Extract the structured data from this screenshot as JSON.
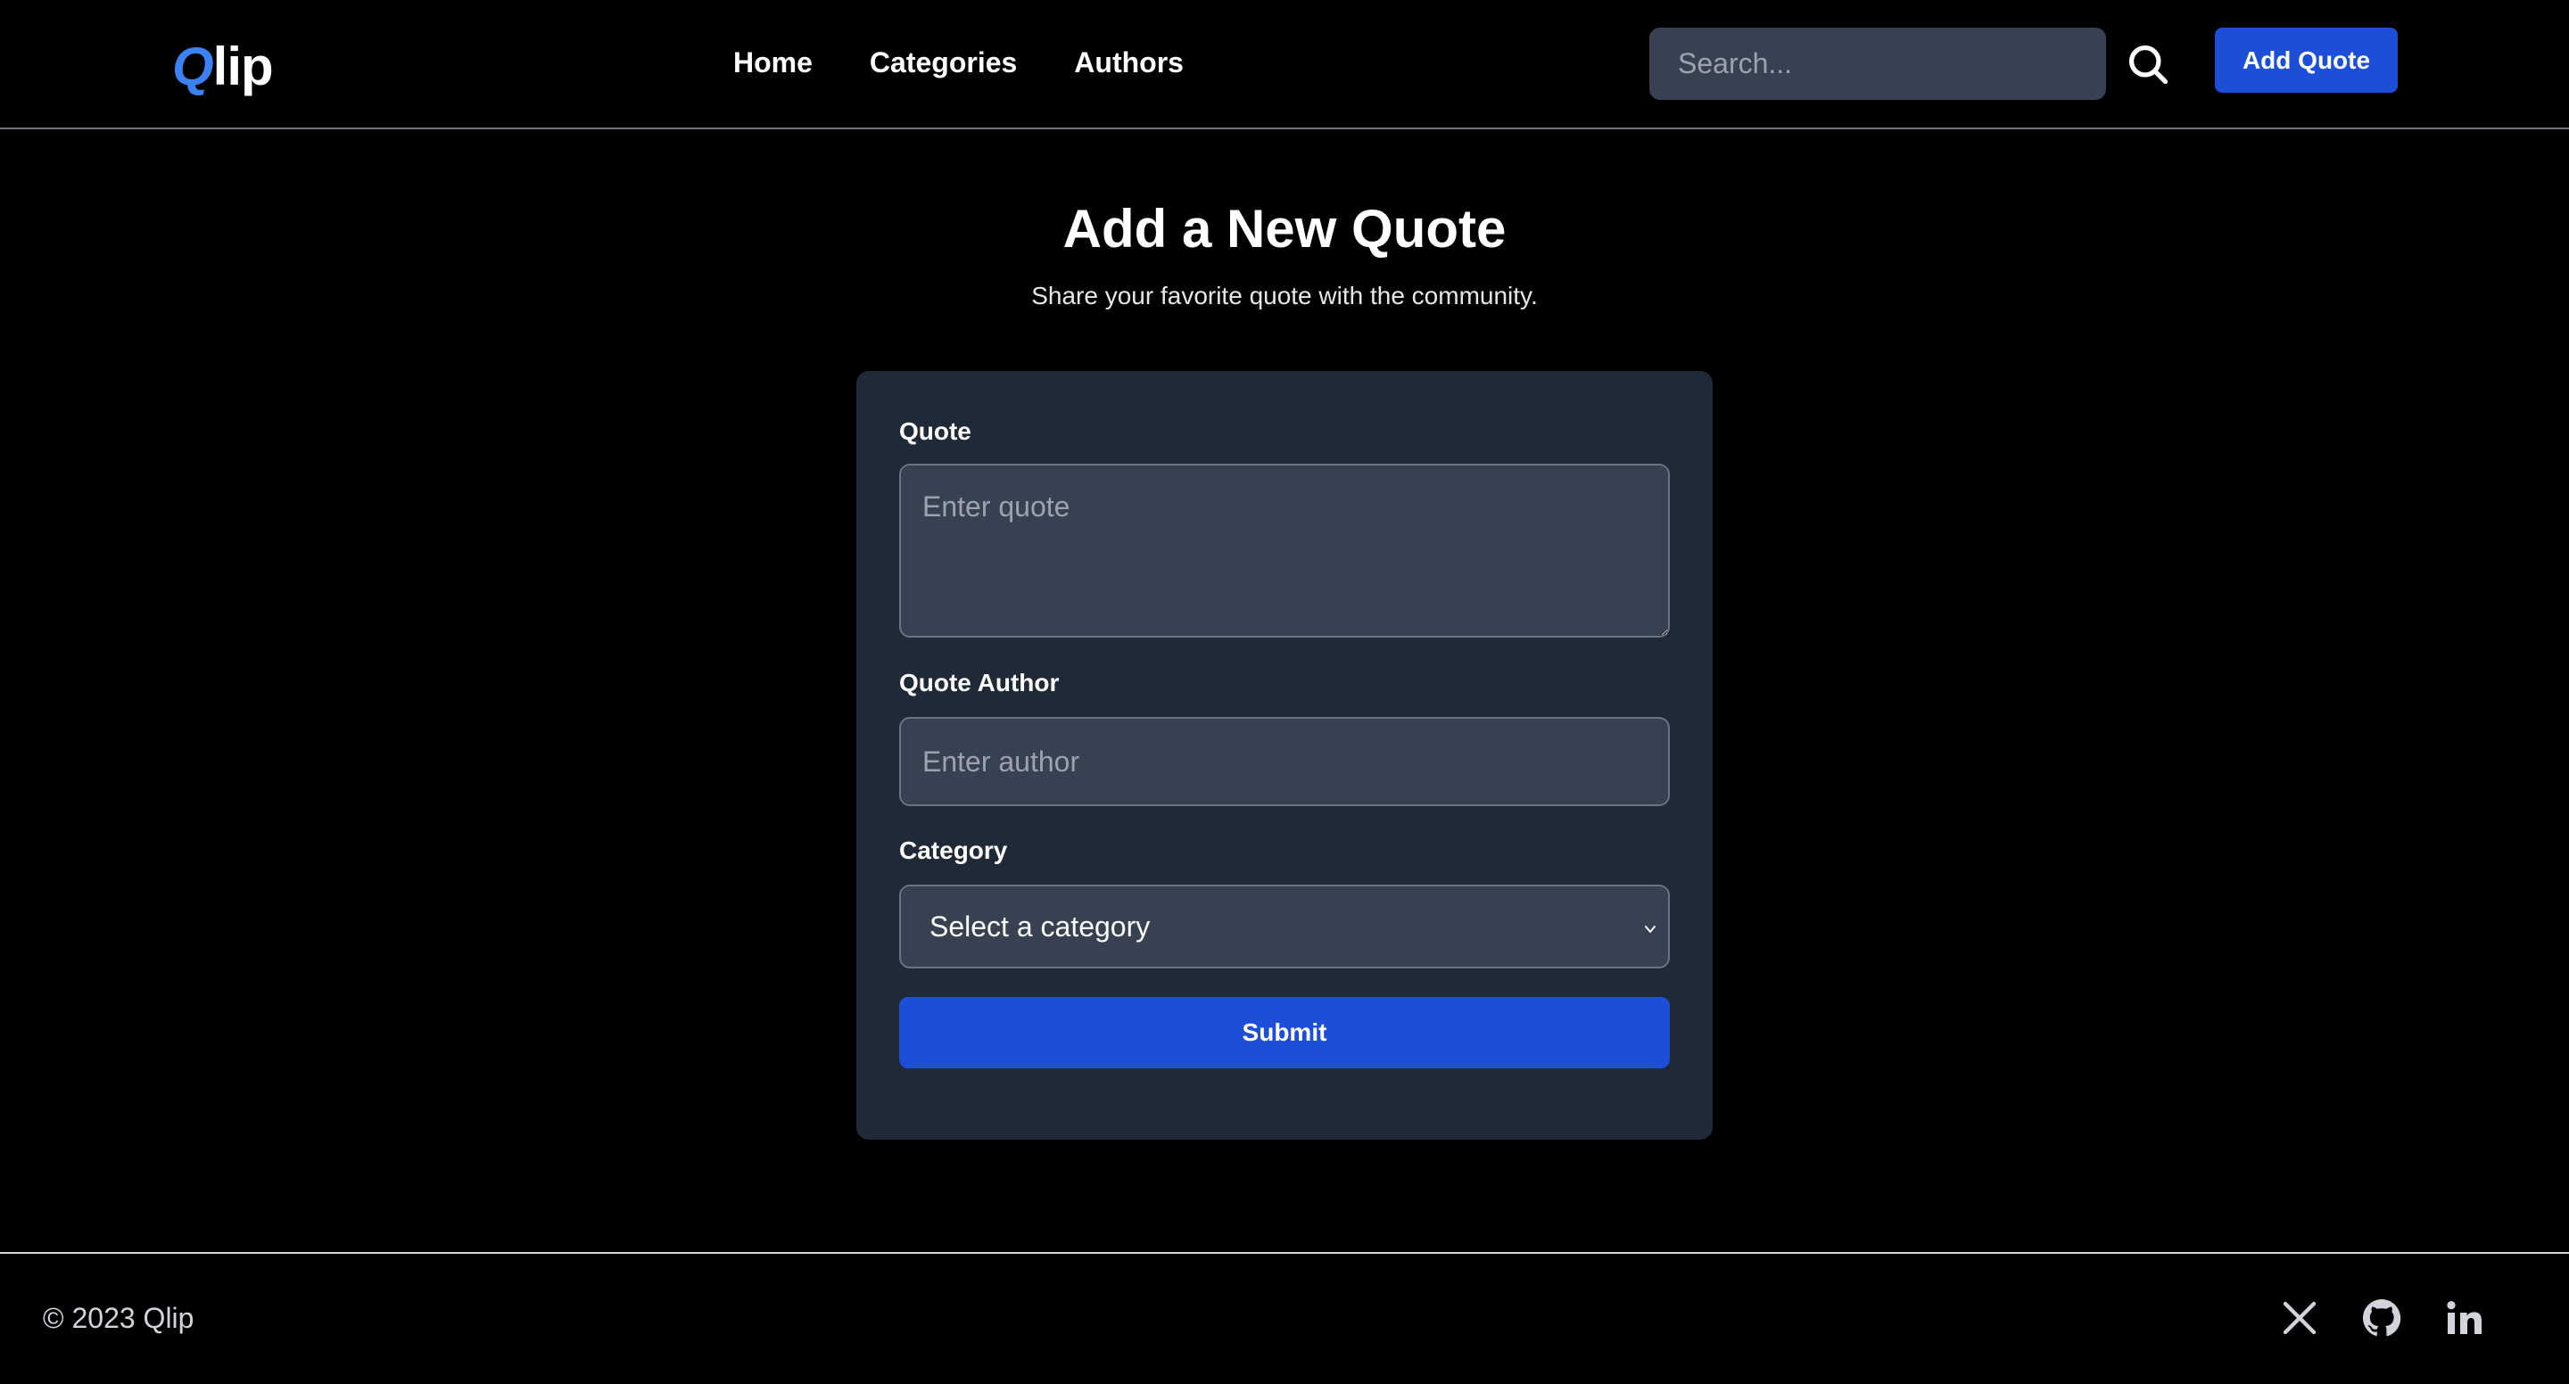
{
  "header": {
    "logo_q": "Q",
    "logo_rest": "lip",
    "nav": [
      {
        "label": "Home"
      },
      {
        "label": "Categories"
      },
      {
        "label": "Authors"
      }
    ],
    "search_placeholder": "Search...",
    "search_icon": "search-icon",
    "add_quote_label": "Add Quote"
  },
  "main": {
    "title": "Add a New Quote",
    "subtitle": "Share your favorite quote with the community.",
    "form": {
      "quote_label": "Quote",
      "quote_placeholder": "Enter quote",
      "author_label": "Quote Author",
      "author_placeholder": "Enter author",
      "category_label": "Category",
      "category_selected": "Select a category",
      "submit_label": "Submit"
    }
  },
  "footer": {
    "copyright": "© 2023 Qlip",
    "social": [
      "x-icon",
      "github-icon",
      "linkedin-icon"
    ]
  },
  "colors": {
    "accent": "#1d4ed8",
    "logo_accent": "#3b82f6",
    "card_bg": "#1f2937",
    "input_bg": "#374151",
    "page_bg": "#000000"
  }
}
